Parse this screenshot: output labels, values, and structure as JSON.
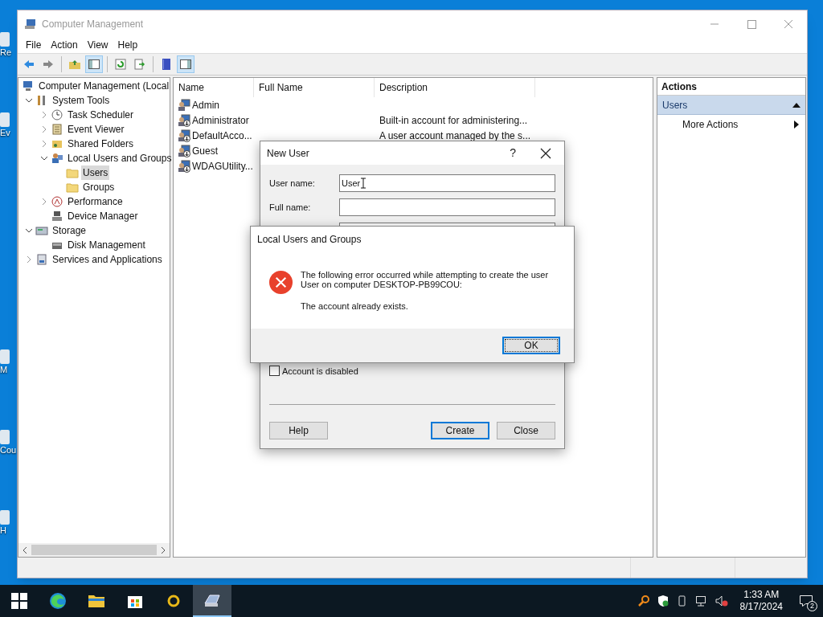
{
  "desktop": {
    "icons": [
      {
        "label": "Re"
      },
      {
        "label": "Ev"
      },
      {
        "label": "M"
      },
      {
        "label": "Cou"
      },
      {
        "label": "H"
      }
    ]
  },
  "window": {
    "title": "Computer Management",
    "menu": [
      "File",
      "Action",
      "View",
      "Help"
    ],
    "toolbar": [
      {
        "kind": "back",
        "pressed": false
      },
      {
        "kind": "forward",
        "pressed": false
      },
      {
        "kind": "sep"
      },
      {
        "kind": "up",
        "pressed": false
      },
      {
        "kind": "tree",
        "pressed": true
      },
      {
        "kind": "sep"
      },
      {
        "kind": "refresh",
        "pressed": false
      },
      {
        "kind": "export",
        "pressed": false
      },
      {
        "kind": "sep"
      },
      {
        "kind": "help",
        "pressed": false
      },
      {
        "kind": "pane",
        "pressed": true
      }
    ],
    "tree": [
      {
        "label": "Computer Management (Local",
        "kind": "computer",
        "selected": false,
        "children": [
          {
            "label": "System Tools",
            "kind": "tools",
            "expanded": true,
            "selected": false,
            "children": [
              {
                "label": "Task Scheduler",
                "kind": "clock",
                "expanded": false,
                "selected": false
              },
              {
                "label": "Event Viewer",
                "kind": "log",
                "expanded": false,
                "selected": false
              },
              {
                "label": "Shared Folders",
                "kind": "share",
                "expanded": false,
                "selected": false
              },
              {
                "label": "Local Users and Groups",
                "kind": "users",
                "expanded": true,
                "selected": false,
                "children": [
                  {
                    "label": "Users",
                    "kind": "folder",
                    "selected": true
                  },
                  {
                    "label": "Groups",
                    "kind": "folder",
                    "selected": false
                  }
                ]
              },
              {
                "label": "Performance",
                "kind": "gauge",
                "expanded": false,
                "selected": false
              },
              {
                "label": "Device Manager",
                "kind": "device",
                "selected": false
              }
            ]
          },
          {
            "label": "Storage",
            "kind": "storage",
            "expanded": true,
            "selected": false,
            "children": [
              {
                "label": "Disk Management",
                "kind": "disk",
                "selected": false
              }
            ]
          },
          {
            "label": "Services and Applications",
            "kind": "services",
            "expanded": false,
            "selected": false
          }
        ]
      }
    ],
    "list": {
      "columns": [
        "Name",
        "Full Name",
        "Description"
      ],
      "rows": [
        {
          "name": "Admin",
          "disabled": false
        },
        {
          "name": "Administrator",
          "disabled": true,
          "description": "Built-in account for administering..."
        },
        {
          "name": "DefaultAcco...",
          "disabled": true,
          "description": "A user account managed by the s..."
        },
        {
          "name": "Guest",
          "disabled": true
        },
        {
          "name": "WDAGUtility...",
          "disabled": true
        }
      ]
    },
    "actions": {
      "title": "Actions",
      "section": "Users",
      "items": [
        "More Actions"
      ]
    }
  },
  "new_user_dialog": {
    "title": "New User",
    "help": "?",
    "fields": [
      {
        "label": "User name:",
        "value": "User"
      },
      {
        "label": "Full name:"
      }
    ],
    "checkbox": {
      "label": "Account is disabled",
      "checked": false
    },
    "buttons": [
      {
        "label": "Help",
        "default": false
      },
      {
        "label": "Create",
        "default": true
      },
      {
        "label": "Close",
        "default": false
      }
    ]
  },
  "error_dialog": {
    "title": "Local Users and Groups",
    "message": "The following error occurred while attempting to create the user User on computer DESKTOP-PB99COU:",
    "detail": "The account already exists.",
    "button": "OK"
  },
  "taskbar": {
    "apps": [
      {
        "kind": "start",
        "active": false
      },
      {
        "kind": "edge",
        "active": false
      },
      {
        "kind": "explorer",
        "active": false
      },
      {
        "kind": "store",
        "active": false
      },
      {
        "kind": "ring",
        "active": false
      },
      {
        "kind": "compmgmt",
        "active": true
      }
    ],
    "time": "1:33 AM",
    "date": "8/17/2024",
    "notifications": "2"
  }
}
